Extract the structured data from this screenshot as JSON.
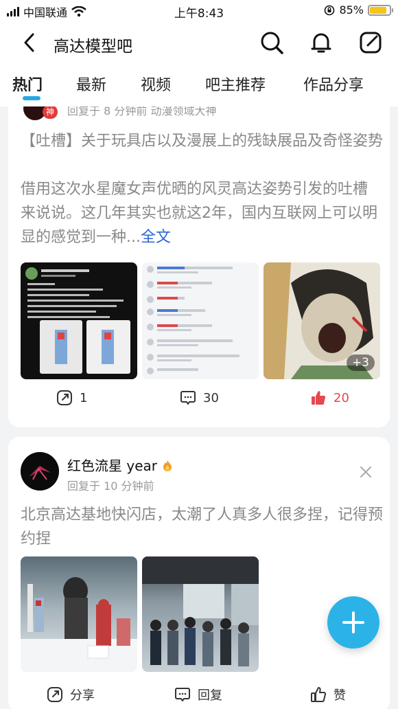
{
  "status_bar": {
    "carrier": "中国联通",
    "time": "上午8:43",
    "battery": "85%",
    "battery_level": 0.85
  },
  "header": {
    "title": "高达模型吧"
  },
  "tabs": [
    {
      "label": "热门",
      "active": true
    },
    {
      "label": "最新",
      "active": false
    },
    {
      "label": "视频",
      "active": false
    },
    {
      "label": "吧主推荐",
      "active": false
    },
    {
      "label": "作品分享",
      "active": false
    }
  ],
  "post1": {
    "badge": "神",
    "reply_info": "回复于 8 分钟前  动漫领域大神",
    "title": "【吐槽】关于玩具店以及漫展上的残缺展品及奇怪姿势",
    "body": "借用这次水星魔女声优晒的风灵高达姿势引发的吐槽来说说。这几年其实也就这2年，国内互联网上可以明显的感觉到一种...",
    "more": "全文",
    "image_more": "+3",
    "share_count": "1",
    "comment_count": "30",
    "like_count": "20"
  },
  "post2": {
    "username": "红色流星 year",
    "reply_info": "回复于 10 分钟前",
    "title": "北京高达基地快闪店，太潮了人真多人很多捏，记得预约捏",
    "share_label": "分享",
    "reply_label": "回复",
    "like_label": "赞"
  },
  "colors": {
    "accent": "#27a8e6",
    "link": "#2a66d6",
    "like": "#e5484d",
    "fab": "#2bb3e8"
  }
}
